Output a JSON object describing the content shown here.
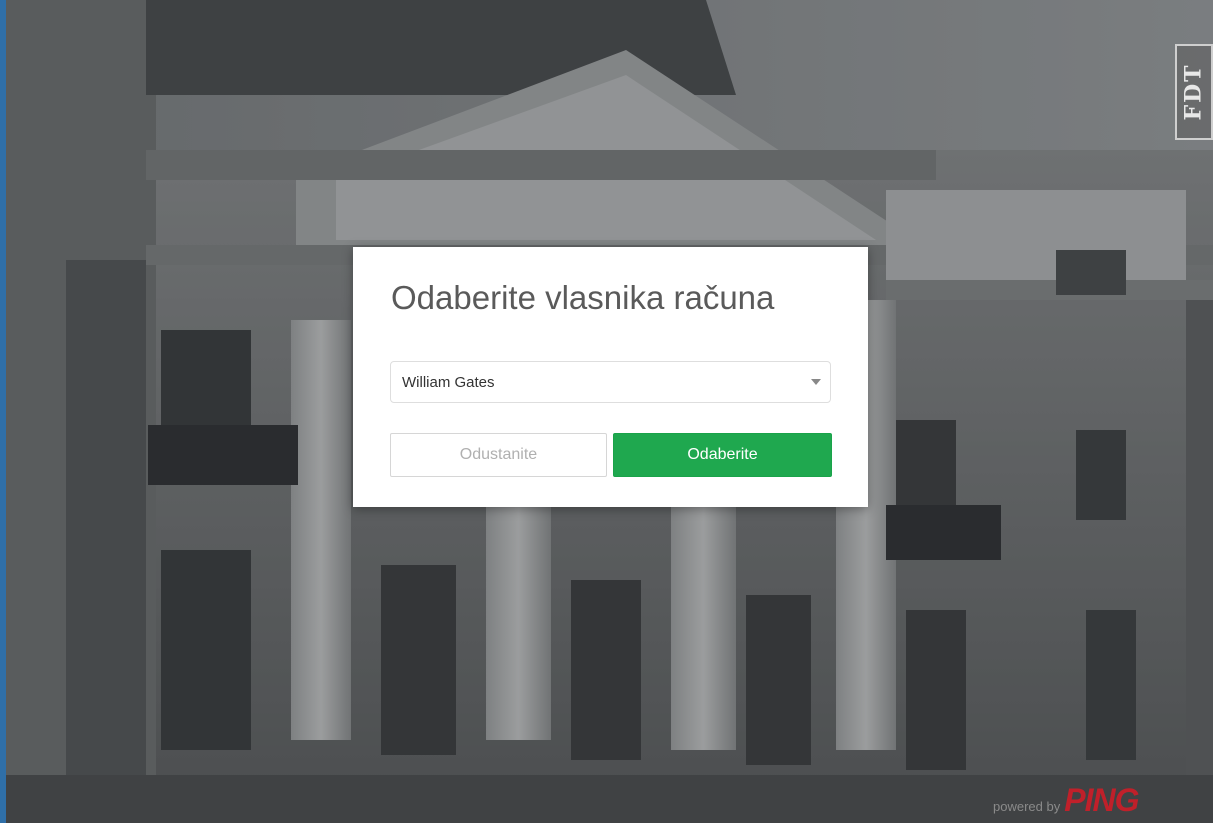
{
  "dialog": {
    "title": "Odaberite vlasnika računa",
    "owner_select": {
      "selected": "William Gates"
    },
    "cancel_label": "Odustanite",
    "confirm_label": "Odaberite"
  },
  "branding": {
    "corner_logo_text": "FDT",
    "powered_by_label": "powered by",
    "powered_by_brand": "PING"
  },
  "colors": {
    "confirm_button": "#1fa84f",
    "brand_red": "#c0202a",
    "left_accent": "#2f6fa8"
  },
  "icons": {
    "select_arrow": "chevron-down-icon"
  }
}
